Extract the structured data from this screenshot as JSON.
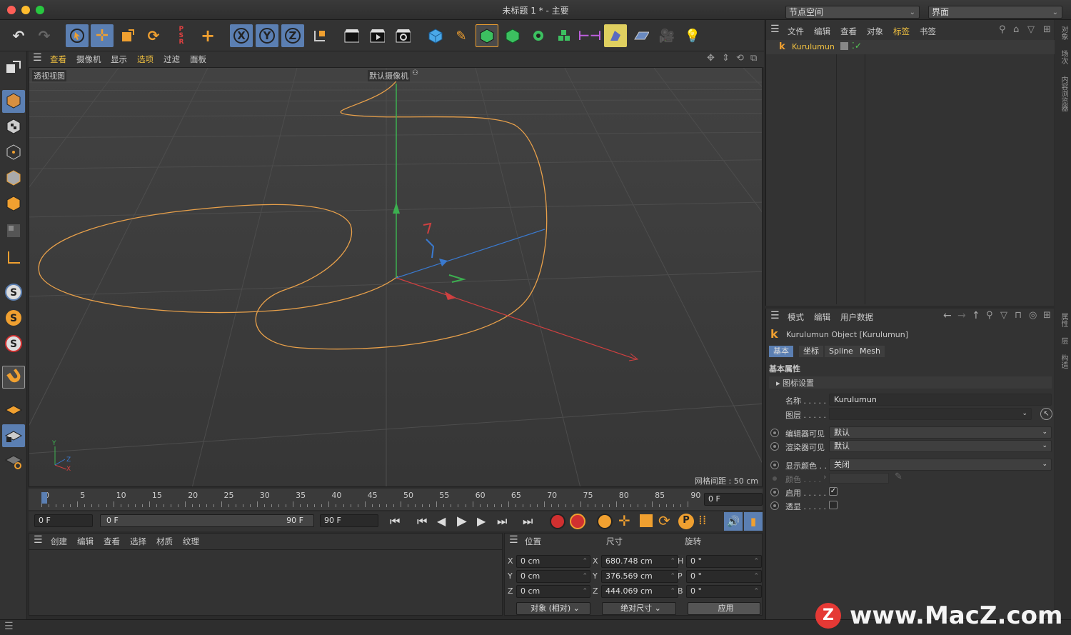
{
  "window": {
    "title": "未标题 1 * - 主要",
    "node_space": "节点空间",
    "layout": "界面"
  },
  "viewport": {
    "menu": [
      "查看",
      "摄像机",
      "显示",
      "选项",
      "过滤",
      "面板"
    ],
    "view_label": "透视视图",
    "camera_label": "默认摄像机",
    "grid_label": "网格间距 : 50 cm"
  },
  "timeline": {
    "ticks": [
      "0",
      "5",
      "10",
      "15",
      "20",
      "25",
      "30",
      "35",
      "40",
      "45",
      "50",
      "55",
      "60",
      "65",
      "70",
      "75",
      "80",
      "85",
      "90"
    ],
    "current": "0 F"
  },
  "transport": {
    "start": "0 F",
    "range_start": "0 F",
    "range_end": "90 F",
    "end": "90 F"
  },
  "material_manager": {
    "menu": [
      "创建",
      "编辑",
      "查看",
      "选择",
      "材质",
      "纹理"
    ]
  },
  "coordinates": {
    "headers": [
      "位置",
      "尺寸",
      "旋转"
    ],
    "rows": [
      {
        "axis": "X",
        "pos": "0 cm",
        "size_axis": "X",
        "size": "680.748 cm",
        "rot_axis": "H",
        "rot": "0 °"
      },
      {
        "axis": "Y",
        "pos": "0 cm",
        "size_axis": "Y",
        "size": "376.569 cm",
        "rot_axis": "P",
        "rot": "0 °"
      },
      {
        "axis": "Z",
        "pos": "0 cm",
        "size_axis": "Z",
        "size": "444.069 cm",
        "rot_axis": "B",
        "rot": "0 °"
      }
    ],
    "mode": "对象 (相对)",
    "size_mode": "绝对尺寸",
    "apply": "应用"
  },
  "object_manager": {
    "menu": [
      "文件",
      "编辑",
      "查看",
      "对象",
      "标签",
      "书签"
    ],
    "object_name": "Kurulumun"
  },
  "attributes": {
    "menu": [
      "模式",
      "编辑",
      "用户数据"
    ],
    "object_title": "Kurulumun Object [Kurulumun]",
    "tabs": [
      "基本",
      "坐标",
      "Spline",
      "Mesh"
    ],
    "section": "基本属性",
    "icon_settings": "图标设置",
    "name_label": "名称 . . . . .",
    "name_value": "Kurulumun",
    "layer_label": "图层 . . . . .",
    "editor_vis_label": "编辑器可见",
    "editor_vis_value": "默认",
    "render_vis_label": "渲染器可见",
    "render_vis_value": "默认",
    "display_color_label": "显示颜色 . .",
    "display_color_value": "关闭",
    "color_label": "颜色 . . . .",
    "enabled_label": "启用 . . . . .",
    "xray_label": "透显 . . . . ."
  },
  "side_tabs": {
    "top": [
      "对象",
      "场次",
      "内容浏览器"
    ],
    "bottom": [
      "属性",
      "层",
      "构造"
    ]
  },
  "watermark": "www.MacZ.com",
  "colors": {
    "accent": "#f0a030",
    "select": "#5b7fb2",
    "spline": "#e8a04a"
  }
}
